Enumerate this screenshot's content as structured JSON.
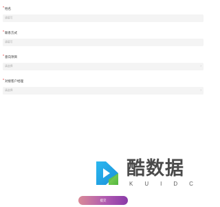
{
  "form": {
    "fields": [
      {
        "label": "姓名",
        "required_mark": "*",
        "value": "请填写",
        "has_chevron": false
      },
      {
        "label": "联系方式",
        "required_mark": "*",
        "value": "请填写",
        "has_chevron": false
      },
      {
        "label": "意向项目",
        "required_mark": "*",
        "value": "请选择",
        "has_chevron": true
      },
      {
        "label": "对接客户经理",
        "required_mark": "*",
        "value": "请选择",
        "has_chevron": true
      }
    ],
    "chevron_icon": "›"
  },
  "watermark": {
    "title": "酷数据",
    "subtitle": "KUIDC"
  },
  "submit": {
    "label": "提交"
  },
  "colors": {
    "required": "#e02020",
    "field_bg": "#f4f4f4",
    "placeholder": "#aaaaaa",
    "button_start": "#d98a97",
    "button_end": "#8a3aa8"
  }
}
